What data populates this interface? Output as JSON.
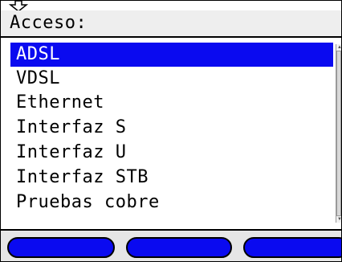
{
  "title": "Acceso:",
  "menu": {
    "items": [
      {
        "label": "ADSL",
        "selected": true
      },
      {
        "label": "VDSL",
        "selected": false
      },
      {
        "label": "Ethernet",
        "selected": false
      },
      {
        "label": "Interfaz S",
        "selected": false
      },
      {
        "label": "Interfaz U",
        "selected": false
      },
      {
        "label": "Interfaz STB",
        "selected": false
      },
      {
        "label": "Pruebas cobre",
        "selected": false
      }
    ]
  },
  "colors": {
    "selection": "#0a0af0",
    "softkey": "#0a0af0",
    "titlebar": "#eeeeee"
  },
  "icons": {
    "top_indicator": "down-arrow-icon"
  }
}
